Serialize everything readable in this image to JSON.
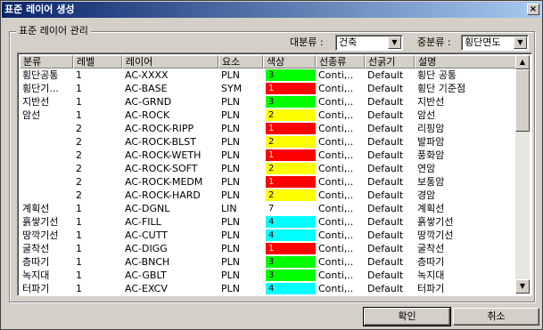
{
  "window": {
    "title": "표준 레이어 생성",
    "close": "×"
  },
  "group": {
    "label": "표준 레이어 관리"
  },
  "filters": {
    "major_label": "대분류 :",
    "major_value": "건축",
    "minor_label": "중분류 :",
    "minor_value": "횡단면도"
  },
  "columns": [
    "분류",
    "레벨",
    "레이어",
    "요소",
    "색상",
    "선종류",
    "선굵기",
    "설명"
  ],
  "rows": [
    {
      "cat": "횡단공통",
      "level": "1",
      "layer": "AC-XXXX",
      "elem": "PLN",
      "color": "3",
      "linetype": "Conti,..",
      "weight": "Default",
      "desc": "횡단 공통"
    },
    {
      "cat": "횡단기...",
      "level": "1",
      "layer": "AC-BASE",
      "elem": "SYM",
      "color": "1",
      "linetype": "Conti,..",
      "weight": "Default",
      "desc": "횡단 기준점"
    },
    {
      "cat": "지반선",
      "level": "1",
      "layer": "AC-GRND",
      "elem": "PLN",
      "color": "3",
      "linetype": "Conti,..",
      "weight": "Default",
      "desc": "지반선"
    },
    {
      "cat": "암선",
      "level": "1",
      "layer": "AC-ROCK",
      "elem": "PLN",
      "color": "2",
      "linetype": "Conti,..",
      "weight": "Default",
      "desc": "암선"
    },
    {
      "cat": "",
      "level": "2",
      "layer": "AC-ROCK-RIPP",
      "elem": "PLN",
      "color": "1",
      "linetype": "Conti,..",
      "weight": "Default",
      "desc": "리핑암"
    },
    {
      "cat": "",
      "level": "2",
      "layer": "AC-ROCK-BLST",
      "elem": "PLN",
      "color": "2",
      "linetype": "Conti,..",
      "weight": "Default",
      "desc": "발파암"
    },
    {
      "cat": "",
      "level": "2",
      "layer": "AC-ROCK-WETH",
      "elem": "PLN",
      "color": "1",
      "linetype": "Conti,..",
      "weight": "Default",
      "desc": "풍화암"
    },
    {
      "cat": "",
      "level": "2",
      "layer": "AC-ROCK-SOFT",
      "elem": "PLN",
      "color": "2",
      "linetype": "Conti,..",
      "weight": "Default",
      "desc": "연암"
    },
    {
      "cat": "",
      "level": "2",
      "layer": "AC-ROCK-MEDM",
      "elem": "PLN",
      "color": "1",
      "linetype": "Conti,..",
      "weight": "Default",
      "desc": "보통암"
    },
    {
      "cat": "",
      "level": "2",
      "layer": "AC-ROCK-HARD",
      "elem": "PLN",
      "color": "2",
      "linetype": "Conti,..",
      "weight": "Default",
      "desc": "경암"
    },
    {
      "cat": "계획선",
      "level": "1",
      "layer": "AC-DGNL",
      "elem": "LIN",
      "color": "7",
      "linetype": "Conti,..",
      "weight": "Default",
      "desc": "계획선"
    },
    {
      "cat": "흙쌓기선",
      "level": "1",
      "layer": "AC-FILL",
      "elem": "PLN",
      "color": "4",
      "linetype": "Conti,..",
      "weight": "Default",
      "desc": "흙쌓기선"
    },
    {
      "cat": "땅깍기선",
      "level": "1",
      "layer": "AC-CUTT",
      "elem": "PLN",
      "color": "4",
      "linetype": "Conti,..",
      "weight": "Default",
      "desc": "땅깍기선"
    },
    {
      "cat": "굴착선",
      "level": "1",
      "layer": "AC-DIGG",
      "elem": "PLN",
      "color": "1",
      "linetype": "Conti,..",
      "weight": "Default",
      "desc": "굴착선"
    },
    {
      "cat": "층따기",
      "level": "1",
      "layer": "AC-BNCH",
      "elem": "PLN",
      "color": "3",
      "linetype": "Conti,..",
      "weight": "Default",
      "desc": "층따기"
    },
    {
      "cat": "녹지대",
      "level": "1",
      "layer": "AC-GBLT",
      "elem": "PLN",
      "color": "3",
      "linetype": "Conti,..",
      "weight": "Default",
      "desc": "녹지대"
    },
    {
      "cat": "터파기",
      "level": "1",
      "layer": "AC-EXCV",
      "elem": "PLN",
      "color": "4",
      "linetype": "Conti,..",
      "weight": "Default",
      "desc": "터파기"
    }
  ],
  "palette": {
    "1": "#ff0000",
    "2": "#ffff00",
    "3": "#00ff00",
    "4": "#00ffff",
    "7": "#ffffff"
  },
  "buttons": {
    "ok": "확인",
    "cancel": "취소"
  },
  "icons": {
    "scroll_up": "▲",
    "scroll_down": "▼",
    "combo_arrow": "▼"
  }
}
